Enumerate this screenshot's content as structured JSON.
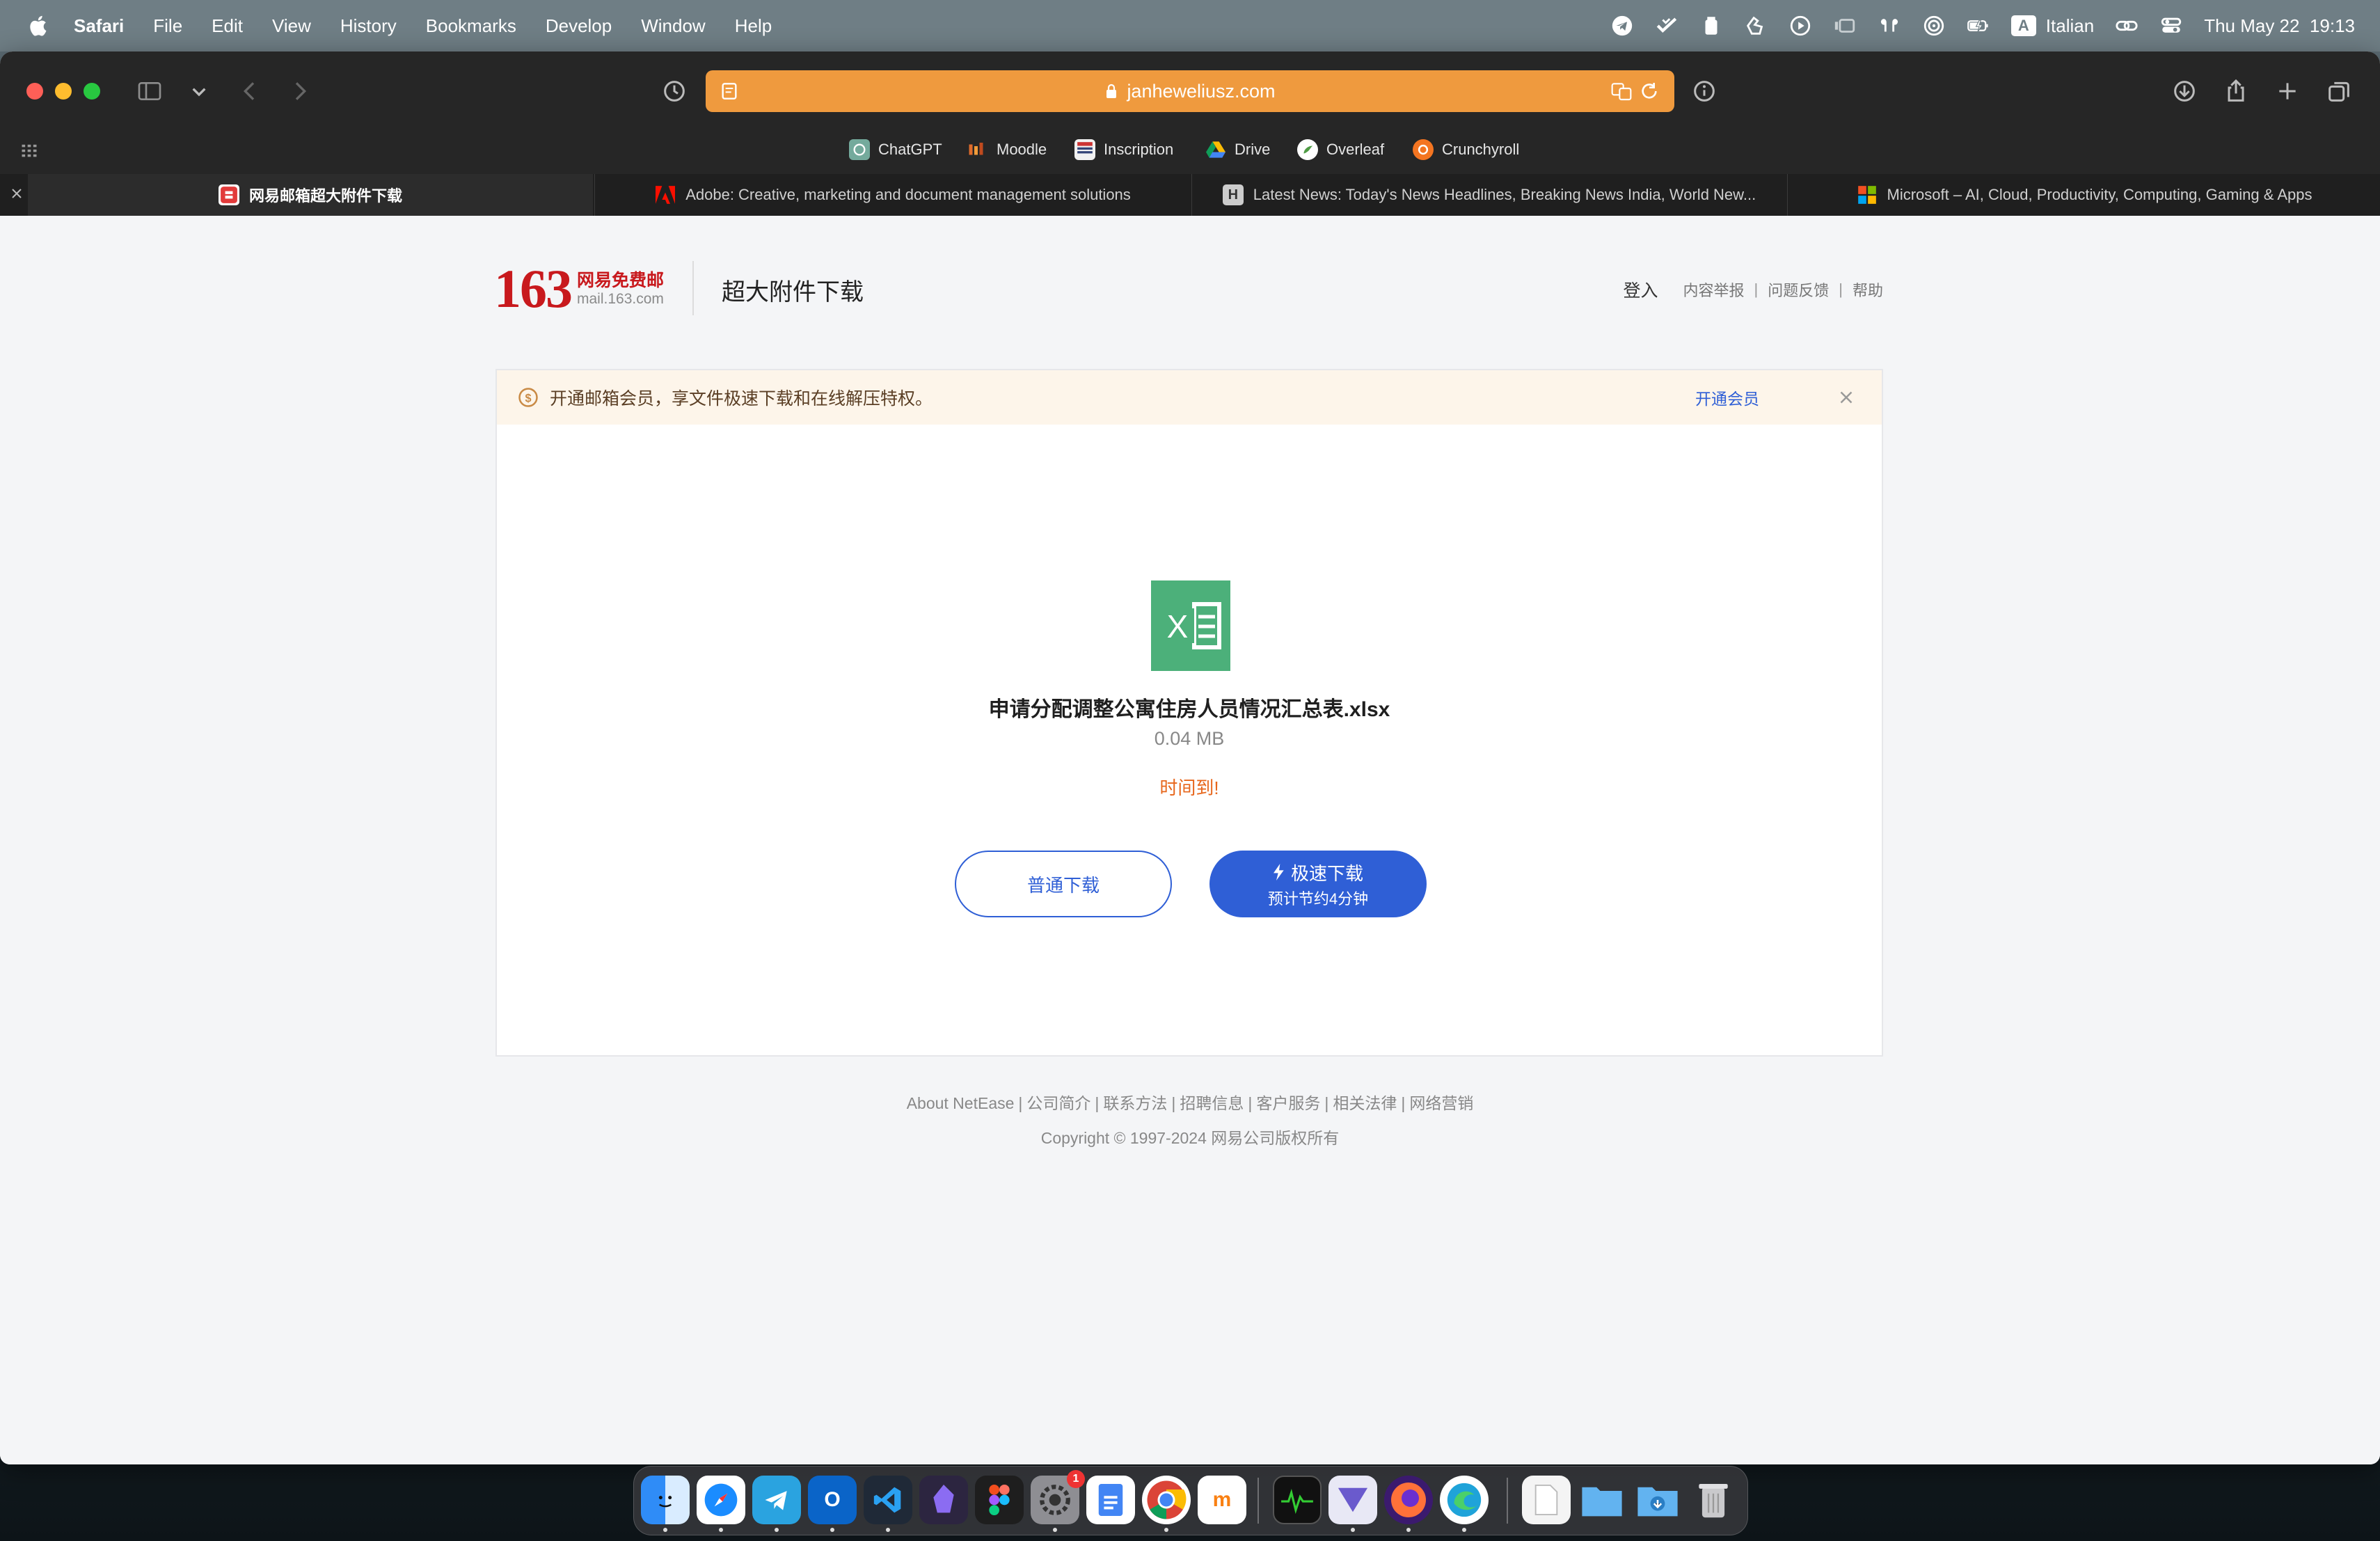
{
  "menubar": {
    "app": "Safari",
    "items": [
      "File",
      "Edit",
      "View",
      "History",
      "Bookmarks",
      "Develop",
      "Window",
      "Help"
    ],
    "input_source": "Italian",
    "input_letter": "A",
    "datetime": "Thu May 22  19:13"
  },
  "browser": {
    "url": "janheweliusz.com",
    "url_bar_color": "#ef9a3e",
    "favorites": [
      {
        "label": "ChatGPT",
        "icon": "chatgpt-icon"
      },
      {
        "label": "Moodle",
        "icon": "moodle-icon"
      },
      {
        "label": "Inscription",
        "icon": "inscription-icon"
      },
      {
        "label": "Drive",
        "icon": "drive-icon"
      },
      {
        "label": "Overleaf",
        "icon": "overleaf-icon"
      },
      {
        "label": "Crunchyroll",
        "icon": "crunchyroll-icon"
      }
    ],
    "tabs": [
      {
        "label": "网易邮箱超大附件下载",
        "icon": "netease-icon",
        "active": true
      },
      {
        "label": "Adobe: Creative, marketing and document management solutions",
        "icon": "adobe-icon",
        "active": false
      },
      {
        "label": "Latest News: Today's News Headlines, Breaking News India, World New...",
        "icon": "h-icon",
        "active": false
      },
      {
        "label": "Microsoft – AI, Cloud, Productivity, Computing, Gaming & Apps",
        "icon": "microsoft-icon",
        "active": false
      }
    ]
  },
  "page": {
    "logo_number": "163",
    "logo_cn": "网易免费邮",
    "logo_en": "mail.163.com",
    "title": "超大附件下载",
    "links": {
      "login": "登入",
      "report": "内容举报",
      "feedback": "问题反馈",
      "help": "帮助",
      "separator": "|"
    },
    "banner": {
      "text": "开通邮箱会员，享文件极速下载和在线解压特权。",
      "action": "开通会员"
    },
    "file": {
      "name": "申请分配调整公寓住房人员情况汇总表.xlsx",
      "size": "0.04 MB",
      "status": "时间到!",
      "icon_letter": "X"
    },
    "buttons": {
      "normal": "普通下载",
      "fast": "极速下载",
      "fast_sub": "预计节约4分钟"
    },
    "footer": {
      "links": [
        "About NetEase",
        "公司简介",
        "联系方法",
        "招聘信息",
        "客户服务",
        "相关法律",
        "网络营销"
      ],
      "copyright": "Copyright © 1997-2024 网易公司版权所有"
    },
    "colors": {
      "accent": "#2f5fd6",
      "warning": "#e7661b",
      "brand_red": "#c8191d",
      "excel_green": "#4cb07a"
    }
  },
  "dock": {
    "apps": [
      "Finder",
      "Safari",
      "Telegram",
      "Outlook",
      "Visual Studio Code",
      "Obsidian",
      "Figma",
      "System Settings",
      "Google Docs",
      "Chrome",
      "Moodle",
      "Activity Monitor",
      "Vectorize",
      "Firefox",
      "Edge",
      "Documents",
      "Files",
      "Downloads",
      "Trash"
    ],
    "settings_badge": "1"
  }
}
